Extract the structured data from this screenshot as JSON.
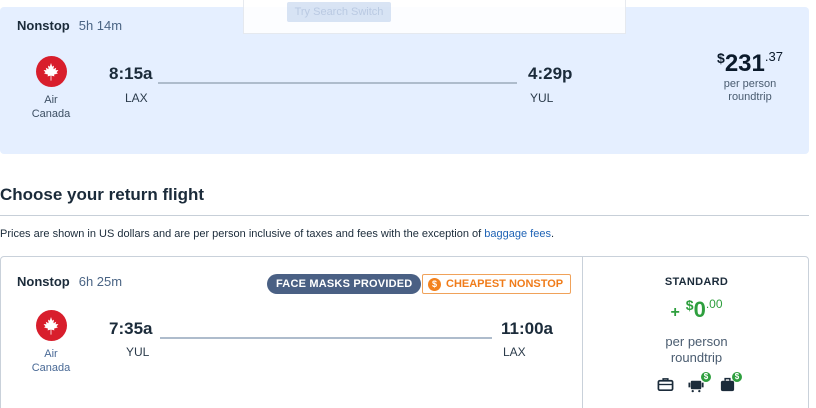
{
  "popup": {
    "button_label": "Try Search Switch"
  },
  "outbound": {
    "stops": "Nonstop",
    "duration": "5h 14m",
    "airline": "Air Canada",
    "depart_time": "8:15a",
    "depart_code": "LAX",
    "arrive_time": "4:29p",
    "arrive_code": "YUL",
    "price": {
      "dollar": "$",
      "whole": "231",
      "cents": ".37",
      "line1": "per person",
      "line2": "roundtrip"
    }
  },
  "section": {
    "title": "Choose your return flight",
    "notice": "Prices are shown in US dollars and are per person inclusive of taxes and fees with the exception of",
    "notice_link": "baggage fees",
    "notice_end": "."
  },
  "return_flight": {
    "stops": "Nonstop",
    "duration": "6h 25m",
    "badge_masks": "FACE MASKS PROVIDED",
    "badge_cheapest": "CHEAPEST NONSTOP",
    "airline": "Air Canada",
    "depart_time": "7:35a",
    "depart_code": "YUL",
    "arrive_time": "11:00a",
    "arrive_code": "LAX",
    "fare": {
      "name": "STANDARD",
      "plus": "+",
      "dollar": "$",
      "whole": "0",
      "cents": ".00",
      "line1": "per person",
      "line2": "roundtrip",
      "amenities": [
        {
          "icon": "personal-item-icon",
          "fee": ""
        },
        {
          "icon": "carry-on-icon",
          "fee": "$"
        },
        {
          "icon": "checked-bag-icon",
          "fee": "$"
        }
      ]
    }
  },
  "colors": {
    "outbound_bg": "#e5efff",
    "accent_green": "#2e9f3e",
    "brand_red": "#d81e2c",
    "badge_orange": "#f07c1a",
    "badge_navy": "#4a6084",
    "link_blue": "#1f63b5"
  }
}
